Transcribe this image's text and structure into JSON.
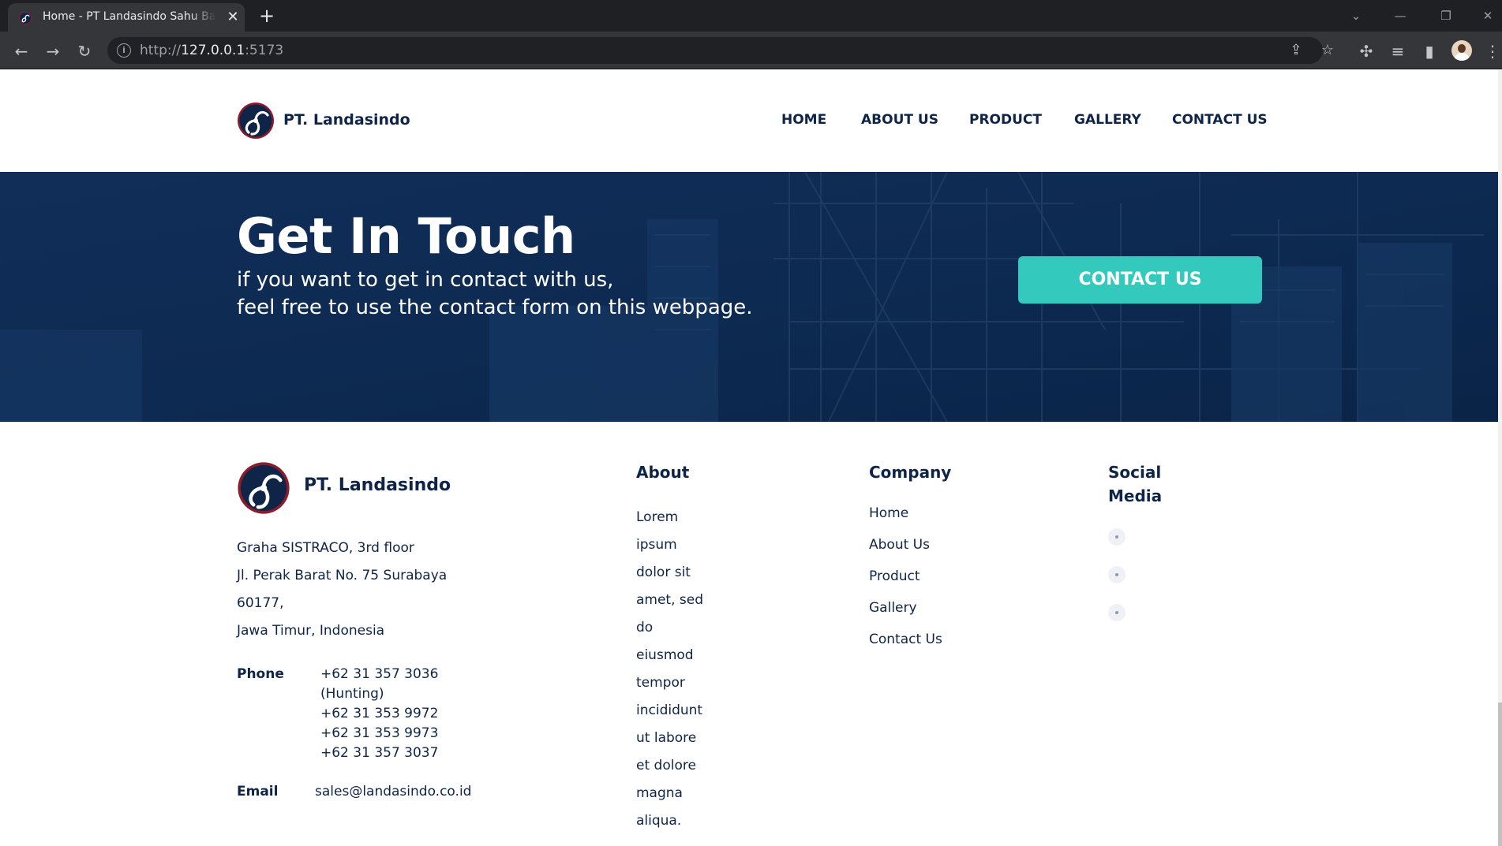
{
  "browser": {
    "tab_title": "Home - PT Landasindo Sahu Bar",
    "url_scheme": "http://",
    "url_host": "127.0.0.1",
    "url_port": ":5173"
  },
  "brand": {
    "name": "PT. Landasindo",
    "logo_colors": {
      "ring": "#8b1c2b",
      "fill": "#0f2547",
      "swirl": "#ffffff"
    }
  },
  "nav": {
    "items": [
      {
        "label": "HOME"
      },
      {
        "label": "ABOUT US"
      },
      {
        "label": "PRODUCT"
      },
      {
        "label": "GALLERY"
      },
      {
        "label": "CONTACT US"
      }
    ]
  },
  "hero": {
    "title": "Get In Touch",
    "subtitle_line1": "if you want to get in contact with us,",
    "subtitle_line2": "feel free to use the contact form on this webpage.",
    "button_label": "CONTACT US",
    "colors": {
      "overlay": "#0d2a52",
      "button": "#33c9bd"
    }
  },
  "footer": {
    "brand_name": "PT. Landasindo",
    "address": [
      "Graha SISTRACO, 3rd floor",
      "Jl. Perak Barat No. 75 Surabaya",
      "60177,",
      "Jawa Timur, Indonesia"
    ],
    "phone_label": "Phone",
    "phones": [
      "+62 31 357 3036",
      "(Hunting)",
      "+62 31 353 9972",
      "+62 31 353 9973",
      "+62 31 357 3037"
    ],
    "email_label": "Email",
    "email": "sales@landasindo.co.id",
    "about": {
      "heading": "About",
      "lines": [
        "Lorem",
        "ipsum",
        "dolor sit",
        "amet, sed",
        "do",
        "eiusmod",
        "tempor",
        "incididunt",
        "ut labore",
        "et dolore",
        "magna",
        "aliqua."
      ]
    },
    "company": {
      "heading": "Company",
      "links": [
        "Home",
        "About Us",
        "Product",
        "Gallery",
        "Contact Us"
      ]
    },
    "social": {
      "heading_line1": "Social",
      "heading_line2": "Media",
      "icons": [
        "social-icon-1",
        "social-icon-2",
        "social-icon-3"
      ]
    }
  },
  "theme": {
    "text_dark": "#0f2547",
    "accent": "#33c9bd"
  }
}
